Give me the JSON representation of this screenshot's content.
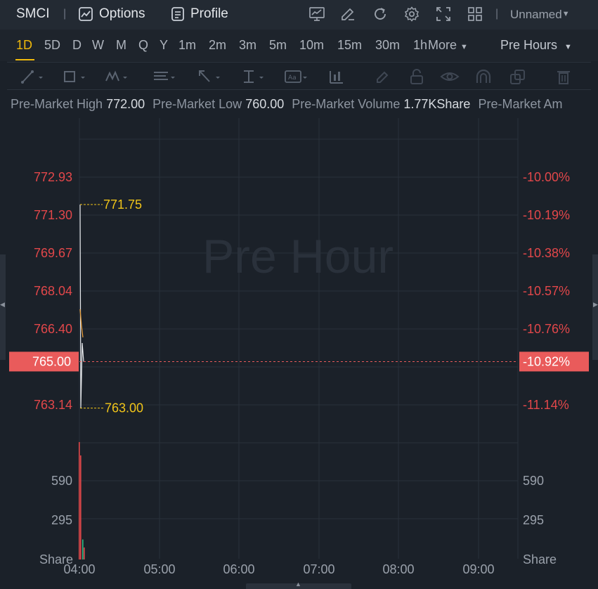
{
  "header": {
    "symbol": "SMCI",
    "separator": "|",
    "options_label": "Options",
    "profile_label": "Profile",
    "layout_name": "Unnamed",
    "icons": [
      "chart-monitor-icon",
      "draw-edit-icon",
      "refresh-icon",
      "settings-icon",
      "fullscreen-icon",
      "grid-layout-icon"
    ]
  },
  "timeframes": [
    "1D",
    "5D",
    "D",
    "W",
    "M",
    "Q",
    "Y",
    "1m",
    "2m",
    "3m",
    "5m",
    "10m",
    "15m",
    "30m",
    "1h"
  ],
  "active_timeframe": "1D",
  "more_label": "More",
  "session_label": "Pre Hours",
  "stats": {
    "high_label": "Pre-Market High",
    "high_value": "772.00",
    "low_label": "Pre-Market Low",
    "low_value": "760.00",
    "volume_label": "Pre-Market Volume",
    "volume_value": "1.77KShare",
    "amount_label": "Pre-Market Am"
  },
  "chart_data": {
    "type": "line",
    "watermark": "Pre Hour",
    "price_ticks": [
      "772.93",
      "771.30",
      "769.67",
      "768.04",
      "766.40",
      "763.14"
    ],
    "pct_ticks": [
      "-10.00%",
      "-10.19%",
      "-10.38%",
      "-10.57%",
      "-10.76%",
      "-11.14%"
    ],
    "current_price": "765.00",
    "current_pct": "-10.92%",
    "high_marker": "771.75",
    "low_marker": "763.00",
    "volume_ticks": [
      "590",
      "295"
    ],
    "volume_unit": "Share",
    "x_ticks": [
      "04:00",
      "05:00",
      "06:00",
      "07:00",
      "08:00",
      "09:00"
    ],
    "price_series": [
      {
        "t": "04:00",
        "price": 771.75
      },
      {
        "t": "04:00",
        "price": 763.0
      },
      {
        "t": "04:01",
        "price": 765.8
      },
      {
        "t": "04:01",
        "price": 765.0
      }
    ],
    "volume_bars": [
      {
        "t": "04:00",
        "volume": 880,
        "color": "#e2474a"
      },
      {
        "t": "04:00",
        "volume": 780,
        "color": "#e2474a"
      },
      {
        "t": "04:01",
        "volume": 150,
        "color": "#2ebd85"
      },
      {
        "t": "04:01",
        "volume": 90,
        "color": "#e2474a"
      }
    ],
    "colors": {
      "down": "#e2474a",
      "up": "#2ebd85",
      "marker": "#f0c419",
      "current_tag": "#e95b5b"
    }
  }
}
